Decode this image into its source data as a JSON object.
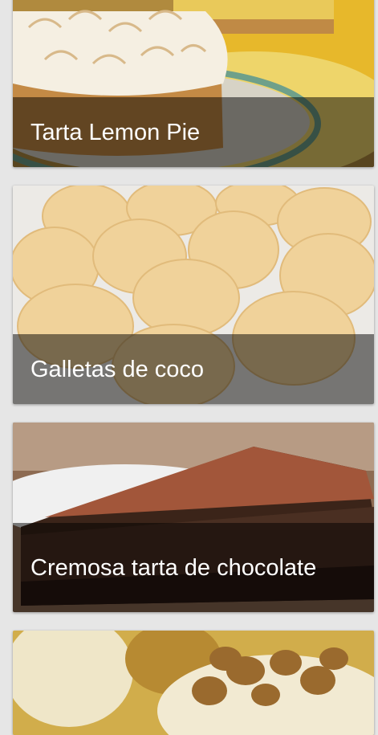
{
  "recipes": [
    {
      "title": "Tarta Lemon Pie"
    },
    {
      "title": "Galletas de coco"
    },
    {
      "title": "Cremosa tarta de chocolate"
    },
    {
      "title": ""
    }
  ]
}
